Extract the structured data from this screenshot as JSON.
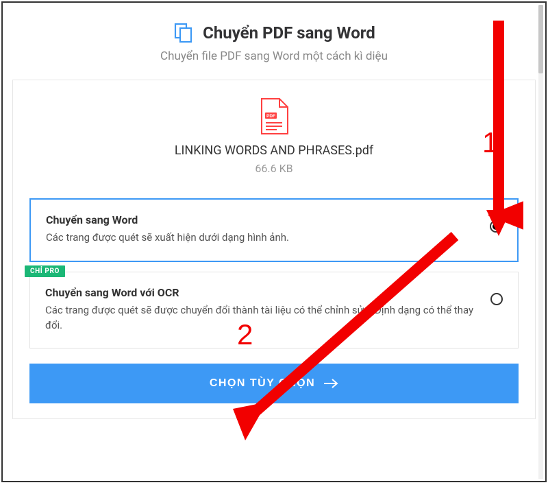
{
  "header": {
    "title": "Chuyển PDF sang Word",
    "subtitle": "Chuyển file PDF sang Word một cách kì diệu"
  },
  "file": {
    "name": "LINKING WORDS AND PHRASES.pdf",
    "size": "66.6 KB",
    "icon_label": "PDF"
  },
  "options": [
    {
      "title": "Chuyển sang Word",
      "desc": "Các trang được quét sẽ xuất hiện dưới dạng hình ảnh.",
      "selected": true,
      "pro": false
    },
    {
      "title": "Chuyển sang Word với OCR",
      "desc": "Các trang được quét sẽ được chuyển đổi thành tài liệu có thể chỉnh sửa. Định dạng có thể thay đổi.",
      "selected": false,
      "pro": true,
      "pro_label": "CHỈ PRO"
    }
  ],
  "button": {
    "label": "CHỌN TÙY CHỌN"
  },
  "annotations": {
    "1": "1",
    "2": "2"
  },
  "colors": {
    "accent": "#3d99f5",
    "pro": "#1bb776",
    "annotation": "#f20000",
    "pdf_icon": "#ff4040"
  }
}
